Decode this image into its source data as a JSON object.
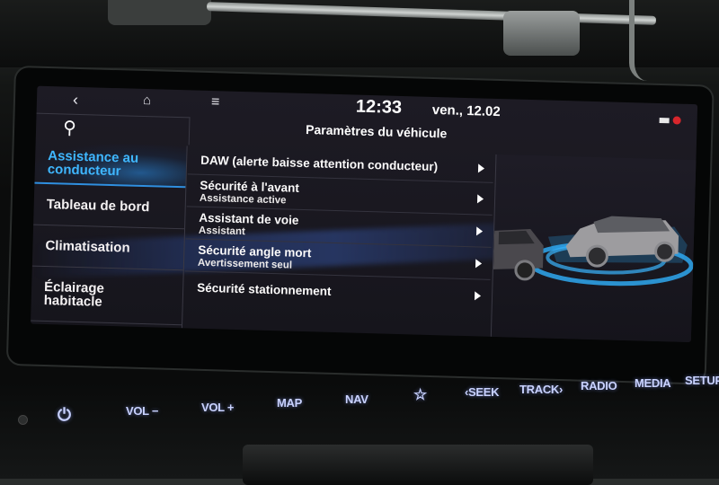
{
  "status_bar": {
    "back_icon": "chevron-left-icon",
    "home_icon": "home-icon",
    "menu_icon": "hamburger-menu-icon",
    "time": "12:33",
    "date": "ven., 12.02",
    "status_icons": [
      "rectangle-indicator-icon",
      "muted-red-icon"
    ]
  },
  "header": {
    "search_icon": "search-icon",
    "title": "Paramètres du véhicule"
  },
  "sidebar": {
    "items": [
      {
        "label": "Assistance au conducteur",
        "active": true
      },
      {
        "label": "Tableau de bord",
        "active": false
      },
      {
        "label": "Climatisation",
        "active": false
      },
      {
        "label": "Éclairage habitacle",
        "active": false
      }
    ]
  },
  "settings_list": {
    "items": [
      {
        "title": "DAW (alerte baisse attention conducteur)",
        "subtitle": ""
      },
      {
        "title": "Sécurité à l'avant",
        "subtitle": "Assistance active"
      },
      {
        "title": "Assistant de voie",
        "subtitle": "Assistant"
      },
      {
        "title": "Sécurité angle mort",
        "subtitle": "Avertissement seul"
      },
      {
        "title": "Sécurité stationnement",
        "subtitle": ""
      }
    ]
  },
  "illustration": {
    "description": "blind-spot-cars-illustration",
    "accent_color": "#2fa8f0"
  },
  "hardware_buttons": [
    {
      "label": "",
      "icon": "power-icon"
    },
    {
      "label": "VOL −"
    },
    {
      "label": "VOL +"
    },
    {
      "label": "MAP"
    },
    {
      "label": "NAV"
    },
    {
      "label": "",
      "icon": "star-icon"
    },
    {
      "label": "‹SEEK"
    },
    {
      "label": "TRACK›"
    },
    {
      "label": "RADIO"
    },
    {
      "label": "MEDIA"
    },
    {
      "label": "SETUP"
    }
  ],
  "colors": {
    "active_menu": "#3fb7ff",
    "button_glow": "#c9d2ff",
    "screen_bg": "#1a1921"
  }
}
